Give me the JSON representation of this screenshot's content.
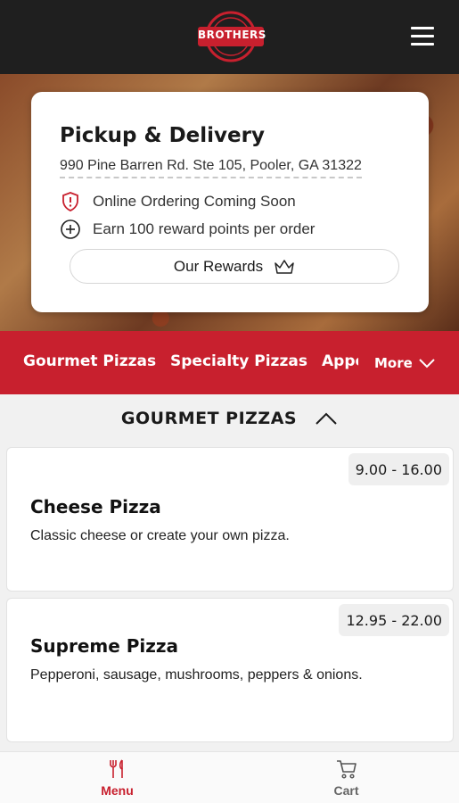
{
  "header": {
    "logo_text": "BROTHERS"
  },
  "location_card": {
    "title": "Pickup & Delivery",
    "address": "990 Pine Barren Rd. Ste 105, Pooler, GA 31322",
    "notice": "Online Ordering Coming Soon",
    "rewards_info": "Earn 100 reward points per order",
    "rewards_button": "Our Rewards"
  },
  "category_nav": {
    "items": [
      "Gourmet Pizzas",
      "Specialty Pizzas",
      "Appetizers"
    ],
    "more_label": "More"
  },
  "section": {
    "title": "GOURMET PIZZAS"
  },
  "menu_items": [
    {
      "name": "Cheese Pizza",
      "description": "Classic cheese or create your own pizza.",
      "price": "9.00 - 16.00"
    },
    {
      "name": "Supreme Pizza",
      "description": "Pepperoni, sausage, mushrooms, peppers & onions.",
      "price": "12.95 - 22.00"
    }
  ],
  "bottom_nav": {
    "menu_label": "Menu",
    "cart_label": "Cart"
  },
  "colors": {
    "brand_red": "#c8202e",
    "header_dark": "#1f1f1f"
  }
}
